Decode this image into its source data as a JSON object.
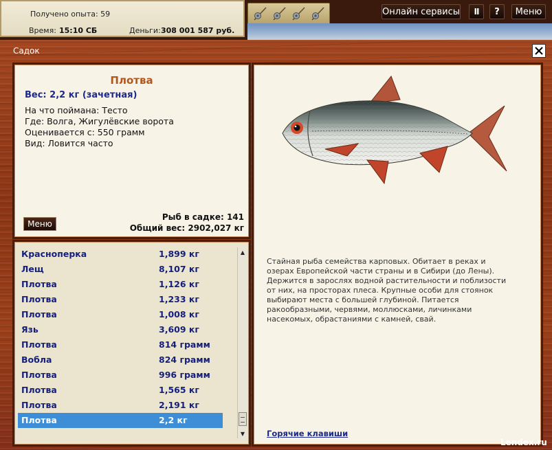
{
  "topbar": {
    "experience": "Получено опыта: 59",
    "time_label": "Время:",
    "time_value": "15:10 СБ",
    "money_label": "Деньги:",
    "money_value": "308 001 587 руб.",
    "gear_icons": [
      "rod-reel-icon",
      "rod-reel-icon",
      "rod-reel-icon",
      "rod-reel-icon"
    ],
    "online_services": "Онлайн сервисы",
    "pause": "II",
    "help": "?",
    "menu": "Меню"
  },
  "window": {
    "title": "Садок",
    "close": "✕"
  },
  "info": {
    "name": "Плотва",
    "weight": "Вес: 2,2 кг (зачетная)",
    "caught_with": "На что поймана: Тесто",
    "caught_where": "Где: Волга, Жигулёвские ворота",
    "valued_from": "Оценивается с: 550 грамм",
    "occurrence": "Вид: Ловится часто",
    "menu_button": "Меню",
    "fish_in_keepnet": "Рыб в садке: 141",
    "total_weight": "Общий вес: 2902,027 кг"
  },
  "fish_list": [
    {
      "name": "Красноперка",
      "weight": "1,899 кг"
    },
    {
      "name": "Лещ",
      "weight": "8,107 кг"
    },
    {
      "name": "Плотва",
      "weight": "1,126 кг"
    },
    {
      "name": "Плотва",
      "weight": "1,233 кг"
    },
    {
      "name": "Плотва",
      "weight": "1,008 кг"
    },
    {
      "name": "Язь",
      "weight": "3,609 кг"
    },
    {
      "name": "Плотва",
      "weight": "814 грамм"
    },
    {
      "name": "Вобла",
      "weight": "824 грамм"
    },
    {
      "name": "Плотва",
      "weight": "996 грамм"
    },
    {
      "name": "Плотва",
      "weight": "1,565 кг"
    },
    {
      "name": "Плотва",
      "weight": "2,191 кг"
    },
    {
      "name": "Плотва",
      "weight": "2,2 кг"
    }
  ],
  "selected_index": 11,
  "description": "Стайная рыба семейства карповых. Обитает в реках и озерах Европейской части страны и в Сибири (до Лены). Держится в зарослях водной растительности и поблизости от них, на просторах плеса. Крупные особи для стоянок выбирают места с большей глубиной. Питается ракообразными, червями, моллюсками, личинками насекомых, обрастаниями с камней, свай.",
  "hotkeys": "Горячие клавиши",
  "watermark": "Lendex.ru",
  "colors": {
    "wood": "#8d3616",
    "panel_bg": "#f7f3e6",
    "fish_name": "#b3561d",
    "list_text": "#15207e",
    "selection": "#3d8ed6"
  }
}
